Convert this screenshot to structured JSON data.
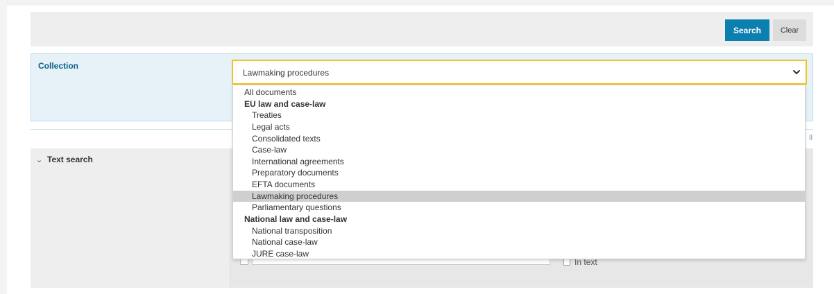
{
  "toolbar": {
    "search_label": "Search",
    "clear_label": "Clear"
  },
  "collection": {
    "label": "Collection",
    "selected": "Lawmaking procedures",
    "options": [
      {
        "label": "All documents",
        "kind": "root"
      },
      {
        "label": "EU law and case-law",
        "kind": "group"
      },
      {
        "label": "Treaties",
        "kind": "child"
      },
      {
        "label": "Legal acts",
        "kind": "child"
      },
      {
        "label": "Consolidated texts",
        "kind": "child"
      },
      {
        "label": "Case-law",
        "kind": "child"
      },
      {
        "label": "International agreements",
        "kind": "child"
      },
      {
        "label": "Preparatory documents",
        "kind": "child"
      },
      {
        "label": "EFTA documents",
        "kind": "child"
      },
      {
        "label": "Lawmaking procedures",
        "kind": "child",
        "selected": true
      },
      {
        "label": "Parliamentary questions",
        "kind": "child"
      },
      {
        "label": "National law and case-law",
        "kind": "group"
      },
      {
        "label": "National transposition",
        "kind": "child"
      },
      {
        "label": "National case-law",
        "kind": "child"
      },
      {
        "label": "JURE case-law",
        "kind": "child"
      }
    ]
  },
  "text_search": {
    "label": "Text search",
    "in_text_label": "In text"
  },
  "misc": {
    "stray_text": "ll"
  },
  "colors": {
    "accent": "#0b7fb0",
    "focus_border": "#f3c11c",
    "panel_bg": "#e6f1f8"
  }
}
